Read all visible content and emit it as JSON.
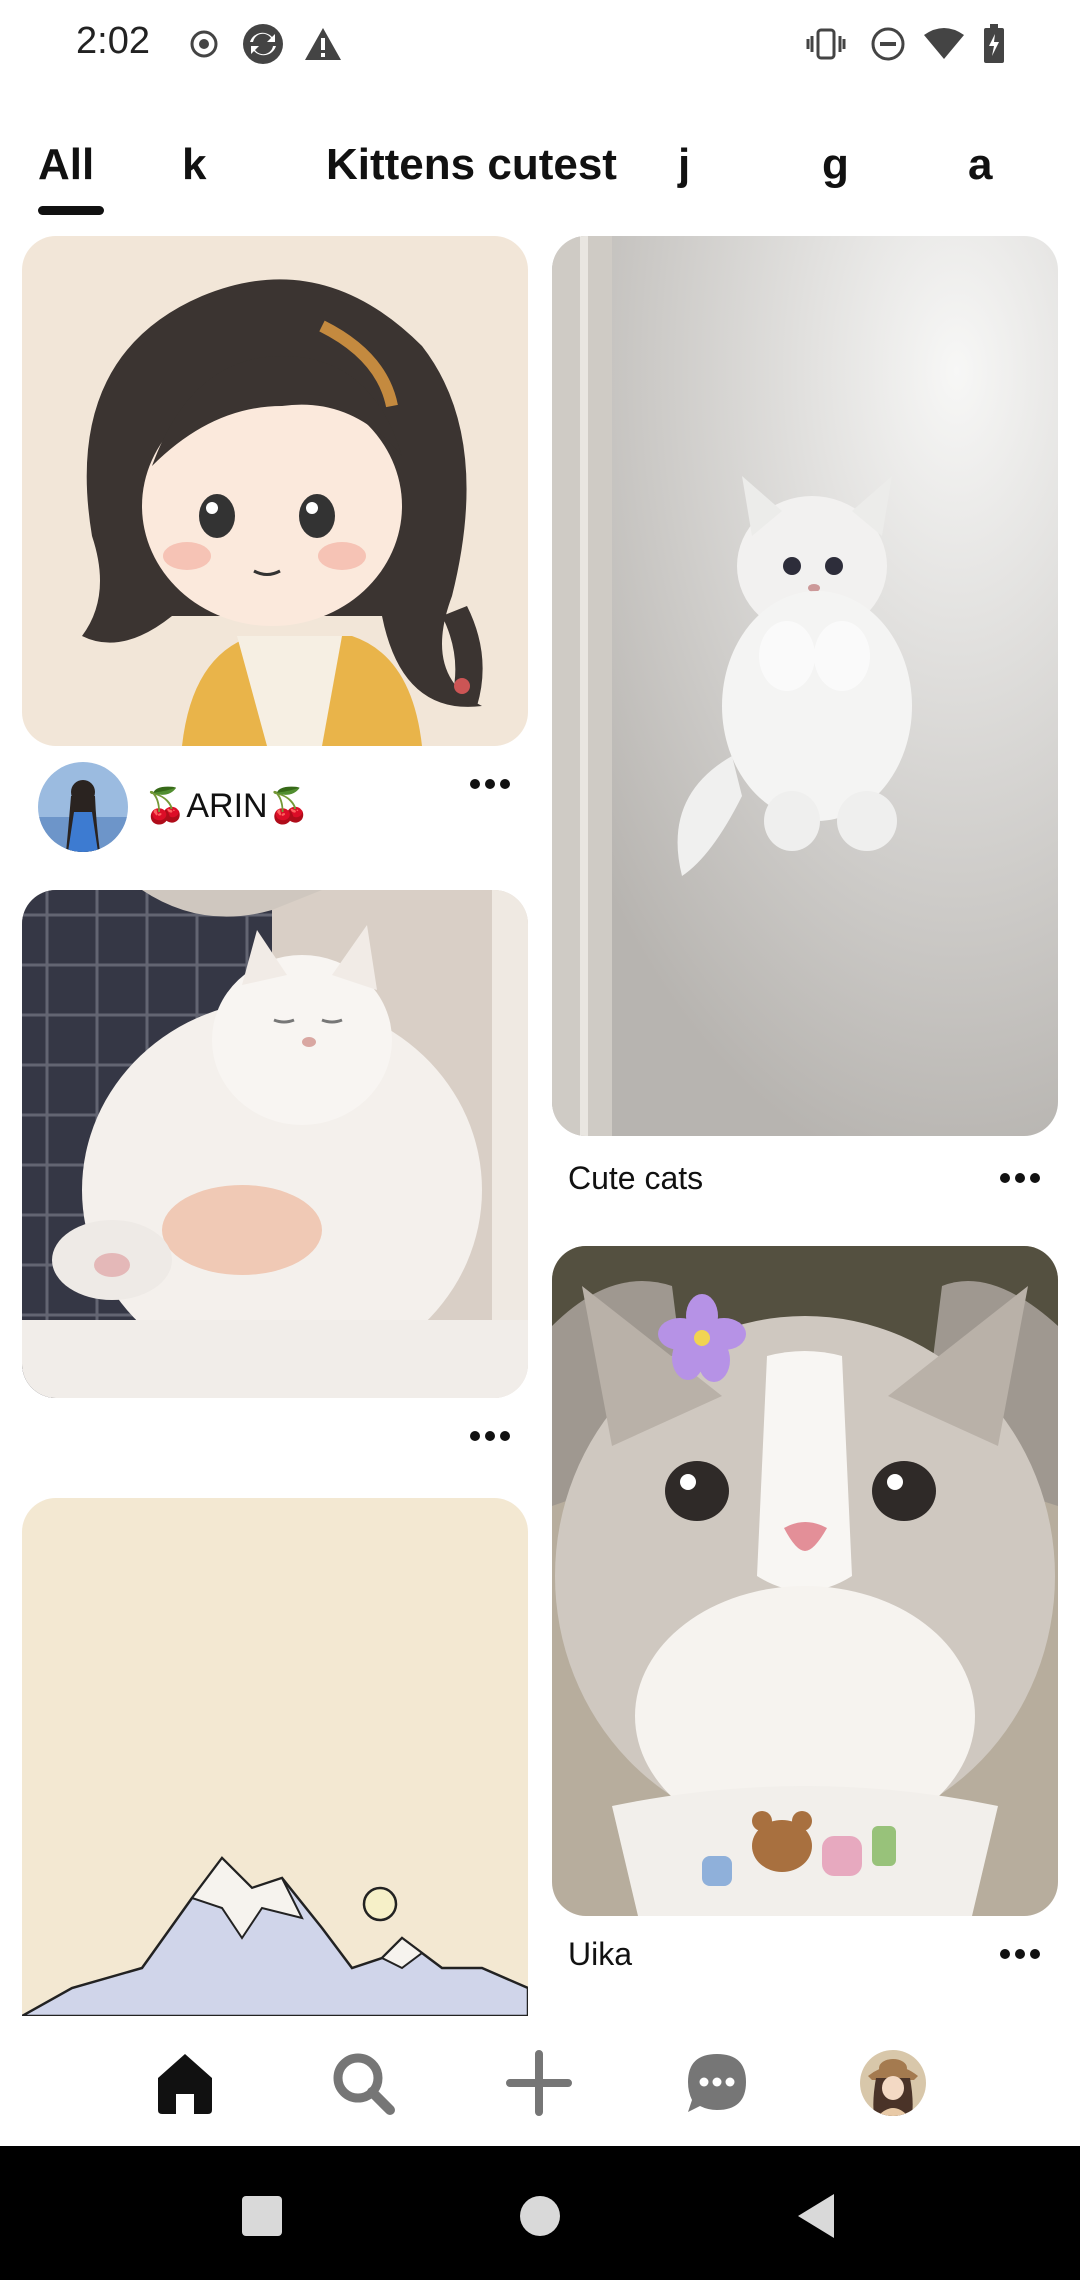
{
  "status_bar": {
    "time": "2:02",
    "left_icons": [
      "record-icon",
      "sync-icon",
      "alert-icon"
    ],
    "right_icons": [
      "vibrate-icon",
      "do-not-disturb-icon",
      "wifi-icon",
      "battery-icon"
    ]
  },
  "tabs": [
    {
      "label": "All",
      "selected": true
    },
    {
      "label": "k",
      "selected": false
    },
    {
      "label": "Kittens cutest",
      "selected": false
    },
    {
      "label": "j",
      "selected": false
    },
    {
      "label": "g",
      "selected": false
    },
    {
      "label": "a",
      "selected": false
    }
  ],
  "pins": {
    "anime_girl": {
      "creator": "🍒ARIN🍒",
      "image": "anime-girl-illustration"
    },
    "white_cat_held": {
      "image": "white-fluffy-cat-held"
    },
    "mountains": {
      "image": "mountain-illustration"
    },
    "cute_cats": {
      "title": "Cute cats",
      "image": "white-kitten-jumping"
    },
    "uika": {
      "title": "Uika",
      "image": "ragdoll-cat-with-flower"
    }
  },
  "bottom_nav": {
    "items": [
      "home-icon",
      "search-icon",
      "create-icon",
      "messages-icon",
      "profile-avatar"
    ],
    "active": "home-icon"
  },
  "colors": {
    "accent": "#111111",
    "icon_gray": "#767676"
  }
}
